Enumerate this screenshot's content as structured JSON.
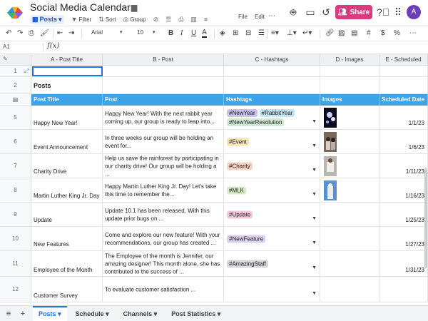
{
  "app": {
    "title": "Social Media Calendar",
    "title_icons": [
      "star-outline-icon",
      "folder-icon"
    ],
    "view_label": "Posts",
    "toolbar": [
      "Filter",
      "Sort",
      "Group"
    ],
    "menus": [
      "File",
      "Edit"
    ],
    "share_label": "Share",
    "avatar_initial": "A",
    "accent": "#d93b7e",
    "header_color": "#3ea3e6"
  },
  "format_toolbar": {
    "font": "Arial",
    "font_size": "10",
    "bold": "B",
    "italic": "I",
    "underline": "U",
    "strike": "S",
    "text_color": "A",
    "currency": "$",
    "percent": "%",
    "more": "⋯"
  },
  "formula_bar": {
    "cell_ref": "A1",
    "fx": "f(x)",
    "value": ""
  },
  "columns": [
    {
      "label": "A - Post Title"
    },
    {
      "label": "B - Post"
    },
    {
      "label": "C - Hashtags"
    },
    {
      "label": "D - Images"
    },
    {
      "label": "E - Scheduled"
    }
  ],
  "section_title": "Posts",
  "table_header": [
    "Post Title",
    "Post",
    "Hashtags",
    "Images",
    "Scheduled Date"
  ],
  "rows": [
    {
      "num": "5",
      "title": "Happy New Year!",
      "post": "Happy New Year! With the next rabbit year coming up, our group is ready to leap into...",
      "tags": [
        {
          "text": "#NewYear",
          "color": "#c9c2f0"
        },
        {
          "text": "#RabbitYear",
          "color": "#c3e6f5"
        },
        {
          "text": "#NewYearResolution",
          "color": "#cfe9d4"
        }
      ],
      "image": "fireworks",
      "date": "1/1/23"
    },
    {
      "num": "6",
      "title": "Event Announcement",
      "post": "In three weeks our group will be holding an event for...",
      "tags": [
        {
          "text": "#Event",
          "color": "#f7e2b4"
        }
      ],
      "image": "people",
      "date": "1/6/23"
    },
    {
      "num": "7",
      "title": "Charity Drive",
      "post": "Help us save the rainforest by participating in our charity drive! Our group will be holding a ...",
      "tags": [
        {
          "text": "#Charity",
          "color": "#f8d3c4"
        }
      ],
      "image": "volunteer",
      "date": "1/11/23"
    },
    {
      "num": "8",
      "title": "Martin Luther King Jr. Day",
      "post": "Happy Martin Luther King Jr. Day! Let's take this time to remember the...",
      "tags": [
        {
          "text": "#MLK",
          "color": "#d6ecc4"
        }
      ],
      "image": "memorial",
      "date": "1/16/23"
    },
    {
      "num": "9",
      "title": "Update",
      "post": "Update 10.1 has been released. With this update prior bugs on ...",
      "tags": [
        {
          "text": "#Update",
          "color": "#f4c8dc"
        }
      ],
      "image": "",
      "date": "1/25/23"
    },
    {
      "num": "10",
      "title": "New Features",
      "post": "Come and explore our new feature! With your recommendations, our group has created ...",
      "tags": [
        {
          "text": "#NewFeature",
          "color": "#dcd0f2"
        }
      ],
      "image": "",
      "date": "1/27/23"
    },
    {
      "num": "11",
      "title": "Employee of the Month",
      "post": "The Employee of the month is Jennifer, our amazing designer! This month alone, she has contributed to the success of ...",
      "tags": [
        {
          "text": "#AmazingStaff",
          "color": "#d5d8dc"
        }
      ],
      "image": "",
      "date": "1/31/23"
    },
    {
      "num": "12",
      "title": "Customer Survey",
      "post": "To evaluate customer satisfaction ...",
      "tags": [],
      "image": "",
      "date": ""
    }
  ],
  "sheet_tabs": [
    "Posts",
    "Schedule",
    "Channels",
    "Post Statistics"
  ]
}
